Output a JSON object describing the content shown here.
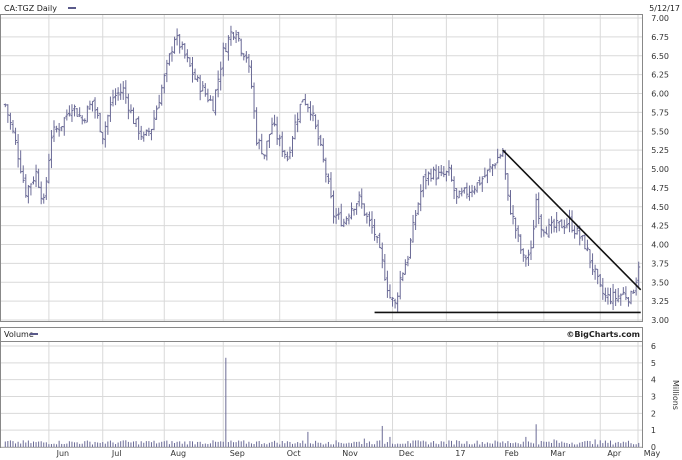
{
  "header": {
    "symbol_label": "CA:TGZ Daily",
    "date_label": "5/12/17",
    "brand": "©BigCharts.com"
  },
  "colors": {
    "price_bar": "#6a6a96",
    "volume_bar": "#6a6a96",
    "grid": "#d9d9d9",
    "trendline": "#111111",
    "legend_swatch": "#5a5a8a"
  },
  "chart_data": [
    {
      "type": "ohlc",
      "title": "CA:TGZ Daily",
      "date_label": "5/12/17",
      "ylim": [
        3.0,
        7.0
      ],
      "y_ticks": [
        "7.00",
        "6.75",
        "6.50",
        "6.25",
        "6.00",
        "5.75",
        "5.50",
        "5.25",
        "5.00",
        "4.75",
        "4.50",
        "4.25",
        "4.00",
        "3.75",
        "3.50",
        "3.25",
        "3.00"
      ],
      "x_ticks": [
        "Jun",
        "Jul",
        "Aug",
        "Sep",
        "Oct",
        "Nov",
        "Dec",
        "17",
        "Feb",
        "Mar",
        "Apr",
        "May"
      ],
      "grid": true,
      "anchors": [
        [
          0,
          5.85
        ],
        [
          4,
          5.35
        ],
        [
          8,
          4.7
        ],
        [
          12,
          4.95
        ],
        [
          15,
          4.55
        ],
        [
          18,
          5.45
        ],
        [
          22,
          5.6
        ],
        [
          26,
          5.85
        ],
        [
          30,
          5.65
        ],
        [
          34,
          5.9
        ],
        [
          38,
          5.45
        ],
        [
          42,
          5.95
        ],
        [
          46,
          6.05
        ],
        [
          50,
          5.65
        ],
        [
          54,
          5.4
        ],
        [
          57,
          5.55
        ],
        [
          62,
          6.2
        ],
        [
          66,
          6.75
        ],
        [
          68,
          6.65
        ],
        [
          70,
          6.5
        ],
        [
          74,
          6.2
        ],
        [
          78,
          6.0
        ],
        [
          81,
          5.85
        ],
        [
          85,
          6.55
        ],
        [
          88,
          6.8
        ],
        [
          90,
          6.85
        ],
        [
          92,
          6.6
        ],
        [
          94,
          6.5
        ],
        [
          96,
          6.1
        ],
        [
          98,
          5.4
        ],
        [
          101,
          5.2
        ],
        [
          104,
          5.6
        ],
        [
          107,
          5.35
        ],
        [
          110,
          5.15
        ],
        [
          113,
          5.6
        ],
        [
          116,
          5.95
        ],
        [
          119,
          5.8
        ],
        [
          122,
          5.4
        ],
        [
          125,
          4.95
        ],
        [
          128,
          4.4
        ],
        [
          132,
          4.3
        ],
        [
          135,
          4.5
        ],
        [
          138,
          4.6
        ],
        [
          141,
          4.35
        ],
        [
          144,
          4.15
        ],
        [
          147,
          3.75
        ],
        [
          150,
          3.3
        ],
        [
          152,
          3.2
        ],
        [
          154,
          3.55
        ],
        [
          157,
          3.85
        ],
        [
          160,
          4.4
        ],
        [
          163,
          4.85
        ],
        [
          166,
          4.95
        ],
        [
          170,
          4.9
        ],
        [
          173,
          4.95
        ],
        [
          176,
          4.6
        ],
        [
          180,
          4.7
        ],
        [
          184,
          4.8
        ],
        [
          188,
          4.95
        ],
        [
          192,
          5.15
        ],
        [
          194,
          5.22
        ],
        [
          196,
          4.6
        ],
        [
          199,
          4.2
        ],
        [
          202,
          3.8
        ],
        [
          205,
          3.9
        ],
        [
          207,
          4.6
        ],
        [
          209,
          4.25
        ],
        [
          212,
          4.2
        ],
        [
          216,
          4.25
        ],
        [
          220,
          4.3
        ],
        [
          223,
          4.15
        ],
        [
          226,
          4.0
        ],
        [
          229,
          3.7
        ],
        [
          232,
          3.4
        ],
        [
          234,
          3.3
        ],
        [
          238,
          3.3
        ],
        [
          241,
          3.35
        ],
        [
          244,
          3.3
        ],
        [
          246,
          3.55
        ],
        [
          247,
          3.75
        ]
      ],
      "trendlines": [
        {
          "name": "resistance",
          "from": [
            194,
            5.25
          ],
          "to": [
            247,
            3.4
          ]
        },
        {
          "name": "support",
          "from": [
            144,
            3.1
          ],
          "to": [
            247,
            3.1
          ]
        }
      ]
    },
    {
      "type": "bar",
      "title": "Volume",
      "ylabel": "Millions",
      "ylim": [
        0,
        6
      ],
      "y_ticks": [
        "6",
        "5",
        "4",
        "3",
        "2",
        "1",
        "0"
      ],
      "spikes": [
        [
          3,
          0.35
        ],
        [
          35,
          0.3
        ],
        [
          47,
          0.4
        ],
        [
          56,
          0.35
        ],
        [
          75,
          0.3
        ],
        [
          86,
          5.3
        ],
        [
          103,
          0.25
        ],
        [
          118,
          0.9
        ],
        [
          126,
          0.3
        ],
        [
          140,
          0.5
        ],
        [
          147,
          1.25
        ],
        [
          150,
          0.6
        ],
        [
          157,
          0.35
        ],
        [
          176,
          0.4
        ],
        [
          196,
          0.35
        ],
        [
          203,
          0.6
        ],
        [
          207,
          1.35
        ],
        [
          214,
          0.45
        ],
        [
          225,
          0.3
        ],
        [
          230,
          0.45
        ],
        [
          239,
          0.3
        ]
      ],
      "baseline": 0.15
    }
  ]
}
